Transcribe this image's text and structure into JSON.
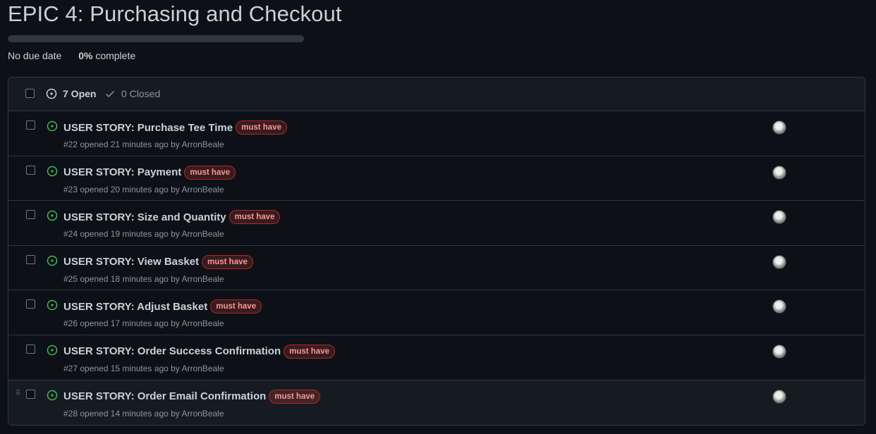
{
  "milestone": {
    "title": "EPIC 4: Purchasing and Checkout",
    "due": "No due date",
    "percent": "0%",
    "percent_suffix": "complete",
    "progress_fraction": 0
  },
  "header": {
    "open_label": "7 Open",
    "closed_label": "0 Closed"
  },
  "issues": [
    {
      "title": "USER STORY: Purchase Tee Time",
      "label": "must have",
      "meta": "#22 opened 21 minutes ago by ArronBeale"
    },
    {
      "title": "USER STORY: Payment",
      "label": "must have",
      "meta": "#23 opened 20 minutes ago by ArronBeale"
    },
    {
      "title": "USER STORY: Size and Quantity",
      "label": "must have",
      "meta": "#24 opened 19 minutes ago by ArronBeale"
    },
    {
      "title": "USER STORY: View Basket",
      "label": "must have",
      "meta": "#25 opened 18 minutes ago by ArronBeale"
    },
    {
      "title": "USER STORY: Adjust Basket",
      "label": "must have",
      "meta": "#26 opened 17 minutes ago by ArronBeale"
    },
    {
      "title": "USER STORY: Order Success Confirmation",
      "label": "must have",
      "meta": "#27 opened 15 minutes ago by ArronBeale"
    },
    {
      "title": "USER STORY: Order Email Confirmation",
      "label": "must have",
      "meta": "#28 opened 14 minutes ago by ArronBeale"
    }
  ],
  "colors": {
    "background": "#0d1117",
    "open_icon": "#3fb950",
    "label_text": "#ff9492",
    "label_border": "#b62324"
  },
  "icons": {
    "open": "issue-opened-icon",
    "closed": "check-icon",
    "drag": "grip-icon"
  }
}
